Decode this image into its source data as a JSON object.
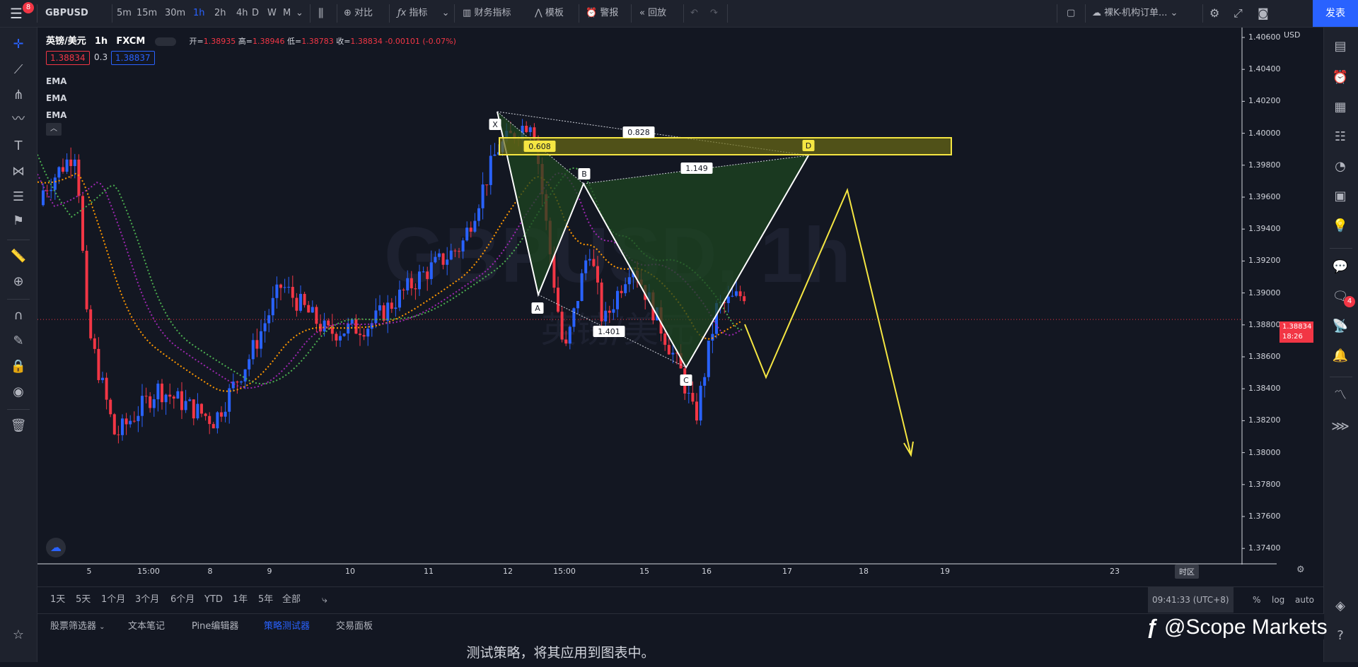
{
  "topbar": {
    "menu_badge": "8",
    "symbol": "GBPUSD",
    "intervals": [
      "5m",
      "15m",
      "30m",
      "1h",
      "2h",
      "4h",
      "D",
      "W",
      "M"
    ],
    "active_interval": "1h",
    "compare": "对比",
    "indicators": "指标",
    "financials": "财务指标",
    "templates": "模板",
    "alert": "警报",
    "replay": "回放",
    "layout_name": "裸K-机构订单...",
    "publish": "发表"
  },
  "legend": {
    "pair": "英镑/美元",
    "interval": "1h",
    "source": "FXCM",
    "o_label": "开=",
    "o": "1.38935",
    "h_label": "高=",
    "h": "1.38946",
    "l_label": "低=",
    "l": "1.38783",
    "c_label": "收=",
    "c": "1.38834",
    "change": "-0.00101 (-0.07%)",
    "bid": "1.38834",
    "spread": "0.3",
    "ask": "1.38837",
    "indicators": [
      "EMA",
      "EMA",
      "EMA"
    ]
  },
  "watermark": {
    "symbol": "GBPUSD, 1h",
    "name": "英镑/美元"
  },
  "price_axis": {
    "currency": "USD",
    "ticks": [
      "1.40600",
      "1.40400",
      "1.40200",
      "1.40000",
      "1.39800",
      "1.39600",
      "1.39400",
      "1.39200",
      "1.39000",
      "1.38800",
      "1.38600",
      "1.38400",
      "1.38200",
      "1.38000",
      "1.37800",
      "1.37600",
      "1.37400"
    ],
    "current_price": "1.38834",
    "countdown": "18:26"
  },
  "time_axis": {
    "ticks": [
      "5",
      "15:00",
      "8",
      "9",
      "10",
      "11",
      "12",
      "15:00",
      "15",
      "16",
      "17",
      "18",
      "19",
      "23"
    ],
    "timezone_label": "时区"
  },
  "pattern": {
    "points": [
      "X",
      "A",
      "B",
      "C",
      "D"
    ],
    "ratios": {
      "xb": "0.608",
      "xd": "0.828",
      "bd": "1.149",
      "ac": "1.401"
    }
  },
  "range_bar": {
    "ranges": [
      "1天",
      "5天",
      "1个月",
      "3个月",
      "6个月",
      "YTD",
      "1年",
      "5年",
      "全部"
    ],
    "clock": "09:41:33 (UTC+8)",
    "percent": "%",
    "log": "log",
    "auto": "auto"
  },
  "bottom_tabs": {
    "tabs": [
      "股票筛选器",
      "文本笔记",
      "Pine编辑器",
      "策略测试器",
      "交易面板"
    ],
    "active": "策略测试器",
    "message": "测试策略，将其应用到图表中。"
  },
  "branding": "@Scope Markets",
  "rightbar": {
    "notification_badge": "4"
  },
  "colors": {
    "up": "#2962ff",
    "down": "#f23645",
    "pattern_fill": "#1e4620",
    "projection": "#f5e642",
    "ema_fast": "#ff9800",
    "ema_mid": "#9c27b0",
    "ema_slow": "#4caf50"
  }
}
